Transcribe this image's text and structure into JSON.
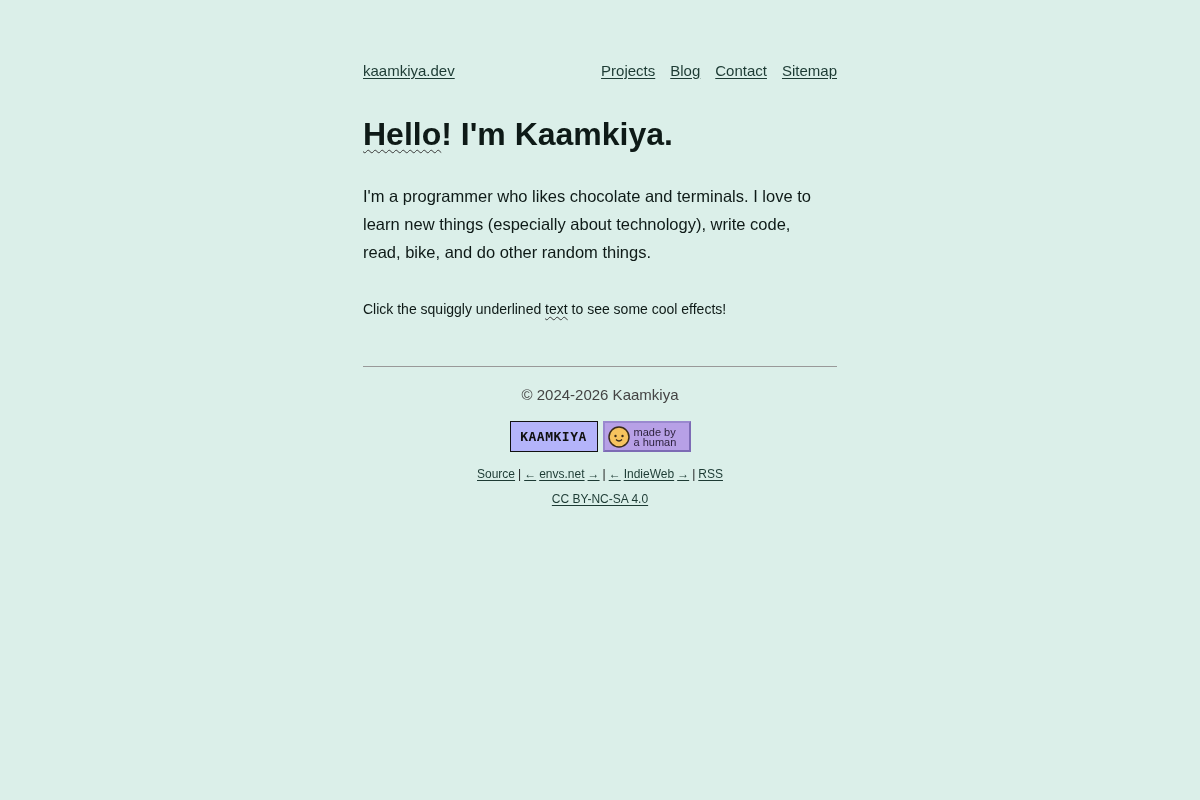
{
  "header": {
    "site_link": "kaamkiya.dev",
    "nav": [
      "Projects",
      "Blog",
      "Contact",
      "Sitemap"
    ]
  },
  "heading": [
    {
      "text": "Hello",
      "squiggly": true
    },
    {
      "text": "! I'm Kaamkiya.",
      "squiggly": false
    }
  ],
  "intro": "I'm a programmer who likes chocolate and terminals. I love to learn new things (especially about technology), write code, read, bike, and do other random things.",
  "hint": [
    {
      "text": "Click the squiggly underlined ",
      "squiggly": false
    },
    {
      "text": "text",
      "squiggly": true
    },
    {
      "text": " to see some cool effects!",
      "squiggly": false
    }
  ],
  "footer": {
    "copyright": "© 2024-2026 Kaamkiya",
    "badges": [
      {
        "kind": "text",
        "label": "KAAMKIYA"
      },
      {
        "kind": "face",
        "lines": [
          "made by",
          "a human"
        ]
      }
    ],
    "links": [
      {
        "kind": "link",
        "text": "Source"
      },
      {
        "kind": "separator",
        "text": "|"
      },
      {
        "kind": "link",
        "text": "←"
      },
      {
        "kind": "link",
        "text": "envs.net"
      },
      {
        "kind": "link",
        "text": "→"
      },
      {
        "kind": "separator",
        "text": "|"
      },
      {
        "kind": "link",
        "text": "←"
      },
      {
        "kind": "link",
        "text": "IndieWeb"
      },
      {
        "kind": "link",
        "text": "→"
      },
      {
        "kind": "separator",
        "text": "|"
      },
      {
        "kind": "link",
        "text": "RSS"
      }
    ],
    "license": "CC BY-NC-SA 4.0"
  }
}
